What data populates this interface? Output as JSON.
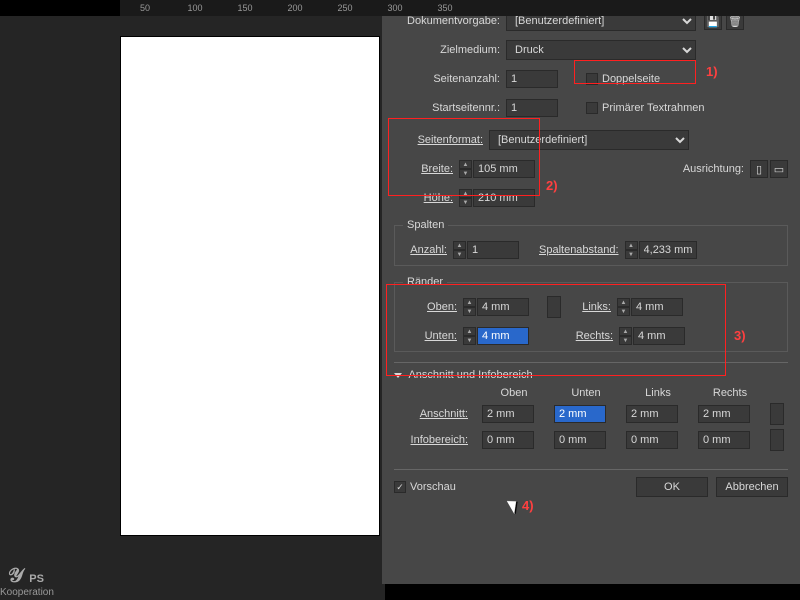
{
  "ruler": [
    "50",
    "100",
    "150",
    "200",
    "250",
    "300",
    "350"
  ],
  "logo": {
    "brand": "PS",
    "sub": "Kooperation"
  },
  "labels": {
    "docpreset": "Dokumentvorgabe:",
    "intent": "Zielmedium:",
    "pages": "Seitenanzahl:",
    "start": "Startseitennr.:",
    "facing": "Doppelseite",
    "primary": "Primärer Textrahmen",
    "pagesize": "Seitenformat:",
    "width": "Breite:",
    "height": "Höhe:",
    "orient": "Ausrichtung:",
    "columns": "Spalten",
    "count": "Anzahl:",
    "gutter": "Spaltenabstand:",
    "margins": "Ränder",
    "top": "Oben:",
    "bottom": "Unten:",
    "left": "Links:",
    "right": "Rechts:",
    "bleedslug": "Anschnitt und Infobereich",
    "bleed": "Anschnitt:",
    "slug": "Infobereich:",
    "hdtop": "Oben",
    "hdbot": "Unten",
    "hdleft": "Links",
    "hdright": "Rechts",
    "preview": "Vorschau",
    "ok": "OK",
    "cancel": "Abbrechen"
  },
  "values": {
    "preset": "[Benutzerdefiniert]",
    "intent": "Druck",
    "pages": "1",
    "start": "1",
    "pagesize": "[Benutzerdefiniert]",
    "width": "105 mm",
    "height": "210 mm",
    "count": "1",
    "gutter": "4,233 mm",
    "mtop": "4 mm",
    "mbot": "4 mm",
    "mleft": "4 mm",
    "mright": "4 mm",
    "btop": "2 mm",
    "bbot": "2 mm",
    "bleft": "2 mm",
    "bright": "2 mm",
    "stop": "0 mm",
    "sbot": "0 mm",
    "sleft": "0 mm",
    "sright": "0 mm"
  },
  "callouts": {
    "c1": "1)",
    "c2": "2)",
    "c3": "3)",
    "c4": "4)"
  }
}
